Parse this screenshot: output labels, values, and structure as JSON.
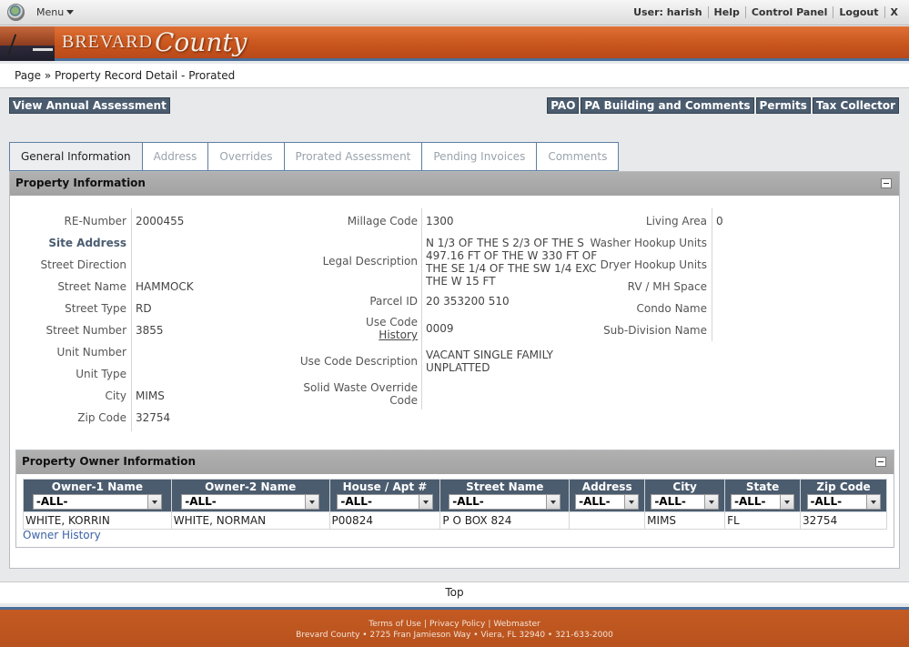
{
  "topbar": {
    "menu_label": "Menu",
    "links": [
      "User: harish",
      "Help",
      "Control Panel",
      "Logout",
      "X"
    ]
  },
  "banner": {
    "title": "BREVARD",
    "script": "County"
  },
  "breadcrumb": "Page » Property Record Detail - Prorated",
  "actions": {
    "annual": "View Annual Assessment",
    "right": [
      "PAO",
      "PA Building and Comments",
      "Permits",
      "Tax Collector"
    ]
  },
  "tabs": [
    {
      "label": "General Information",
      "active": true
    },
    {
      "label": "Address"
    },
    {
      "label": "Overrides"
    },
    {
      "label": "Prorated Assessment"
    },
    {
      "label": "Pending Invoices"
    },
    {
      "label": "Comments"
    }
  ],
  "property": {
    "title": "Property Information",
    "col1": [
      {
        "label": "RE-Number",
        "value": "2000455"
      },
      {
        "label": "Site Address",
        "value": ""
      },
      {
        "label": "Street Direction",
        "value": ""
      },
      {
        "label": "Street Name",
        "value": "HAMMOCK"
      },
      {
        "label": "Street Type",
        "value": "RD"
      },
      {
        "label": "Street Number",
        "value": "3855"
      },
      {
        "label": "Unit Number",
        "value": ""
      },
      {
        "label": "Unit Type",
        "value": ""
      },
      {
        "label": "City",
        "value": "MIMS"
      },
      {
        "label": "Zip Code",
        "value": "32754"
      }
    ],
    "col2": {
      "millage_label": "Millage Code",
      "millage": "1300",
      "legal_label": "Legal Description",
      "legal": "N 1/3 OF THE S 2/3 OF THE S 497.16 FT OF THE W 330 FT OF THE SE 1/4 OF THE SW 1/4 EXC THE W 15 FT",
      "parcel_label": "Parcel ID",
      "parcel": "20 353200 510",
      "use_label": "Use Code",
      "use_history": "History",
      "use": "0009",
      "use_desc_label": "Use Code Description",
      "use_desc": "VACANT SINGLE FAMILY UNPLATTED",
      "solid_label": "Solid Waste Override Code",
      "solid": ""
    },
    "col3": [
      {
        "label": "Living Area",
        "value": "0"
      },
      {
        "label": "Washer Hookup Units",
        "value": ""
      },
      {
        "label": "Dryer Hookup Units",
        "value": ""
      },
      {
        "label": "RV / MH Space",
        "value": ""
      },
      {
        "label": "Condo Name",
        "value": ""
      },
      {
        "label": "Sub-Division Name",
        "value": ""
      }
    ]
  },
  "owners": {
    "title": "Property Owner Information",
    "filter_label": "-ALL-",
    "columns": [
      "Owner-1 Name",
      "Owner-2 Name",
      "House / Apt #",
      "Street Name",
      "Address",
      "City",
      "State",
      "Zip Code"
    ],
    "rows": [
      [
        "WHITE, KORRIN",
        "WHITE, NORMAN",
        "P00824",
        "P O BOX 824",
        "",
        "MIMS",
        "FL",
        "32754"
      ]
    ],
    "history": "Owner History"
  },
  "top_link": "Top",
  "footer": {
    "links": [
      "Terms of Use",
      "Privacy Policy",
      "Webmaster"
    ],
    "address": "Brevard County • 2725 Fran Jamieson Way • Viera, FL 32940 • 321-633-2000"
  }
}
